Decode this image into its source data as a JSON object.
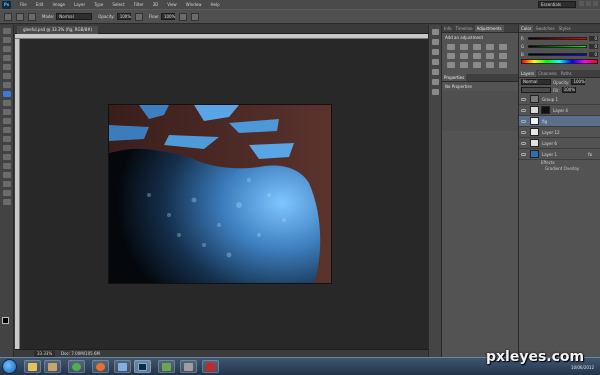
{
  "app": {
    "logo": "Ps",
    "menu": [
      "File",
      "Edit",
      "Image",
      "Layer",
      "Type",
      "Select",
      "Filter",
      "3D",
      "View",
      "Window",
      "Help"
    ],
    "workspace": "Essentials"
  },
  "options": {
    "mode_label": "Mode:",
    "mode_value": "Normal",
    "opacity_label": "Opacity:",
    "opacity_value": "100%",
    "flow_label": "Flow:",
    "flow_value": "100%"
  },
  "document": {
    "tab_title": "gleeful.psd @ 33.3% (fig, RGB/8#)",
    "zoom": "33.33%",
    "doc_info": "Doc: 7.00M/105.6M"
  },
  "adjustments_panel": {
    "tabs": [
      "Info",
      "Timeline",
      "Adjustments"
    ],
    "active_tab": "Adjustments",
    "heading": "Add an adjustment"
  },
  "properties_panel": {
    "tab": "Properties",
    "text": "No Properties"
  },
  "color_panel": {
    "tabs": [
      "Color",
      "Swatches",
      "Styles"
    ],
    "channels": [
      {
        "ch": "R",
        "value": "0"
      },
      {
        "ch": "G",
        "value": "0"
      },
      {
        "ch": "B",
        "value": "0"
      }
    ]
  },
  "layers_panel": {
    "tabs": [
      "Layers",
      "Channels",
      "Paths"
    ],
    "blend_mode": "Normal",
    "opacity_label": "Opacity:",
    "opacity_value": "100%",
    "fill_label": "Fill:",
    "fill_value": "100%",
    "layers": [
      {
        "name": "Group 1",
        "selected": false
      },
      {
        "name": "Layer 4",
        "selected": false
      },
      {
        "name": "fig",
        "selected": true
      },
      {
        "name": "Layer 12",
        "selected": false
      },
      {
        "name": "Layer 6",
        "selected": false
      },
      {
        "name": "Layer 1",
        "selected": false
      }
    ],
    "effects_label": "Effects",
    "effect_item": "Gradient Overlay",
    "fx_badge": "fx"
  },
  "taskbar": {
    "clock": "10:04 PM",
    "date": "10/06/2012"
  },
  "watermark": "pxleyes.com",
  "colors": {
    "accent": "#3a7bd5",
    "canvas_blue": "#3d7fbf",
    "tree_brown": "#4a2a25"
  }
}
